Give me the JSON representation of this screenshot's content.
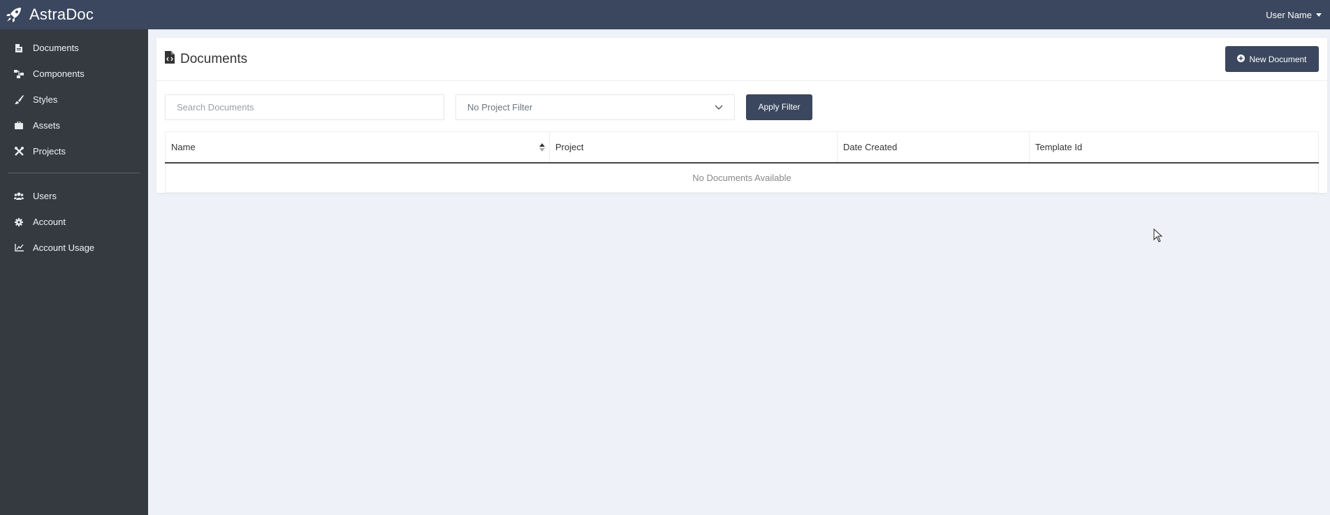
{
  "app": {
    "name": "AstraDoc"
  },
  "header": {
    "user_name": "User Name"
  },
  "sidebar": {
    "items": [
      {
        "label": "Documents",
        "icon": "file-icon"
      },
      {
        "label": "Components",
        "icon": "sitemap-icon"
      },
      {
        "label": "Styles",
        "icon": "brush-icon"
      },
      {
        "label": "Assets",
        "icon": "briefcase-icon"
      },
      {
        "label": "Projects",
        "icon": "tools-icon"
      }
    ],
    "secondary_items": [
      {
        "label": "Users",
        "icon": "users-icon"
      },
      {
        "label": "Account",
        "icon": "gear-icon"
      },
      {
        "label": "Account Usage",
        "icon": "chart-line-icon"
      }
    ]
  },
  "main": {
    "title": "Documents",
    "new_button_label": "New Document",
    "search_placeholder": "Search Documents",
    "project_filter_value": "No Project Filter",
    "apply_filter_label": "Apply Filter",
    "table": {
      "columns": [
        "Name",
        "Project",
        "Date Created",
        "Template Id"
      ],
      "empty_message": "No Documents Available"
    }
  },
  "colors": {
    "topbar": "#3a475e",
    "sidebar": "#343a40",
    "background": "#eef1f7",
    "primary_button": "#3a475e"
  }
}
